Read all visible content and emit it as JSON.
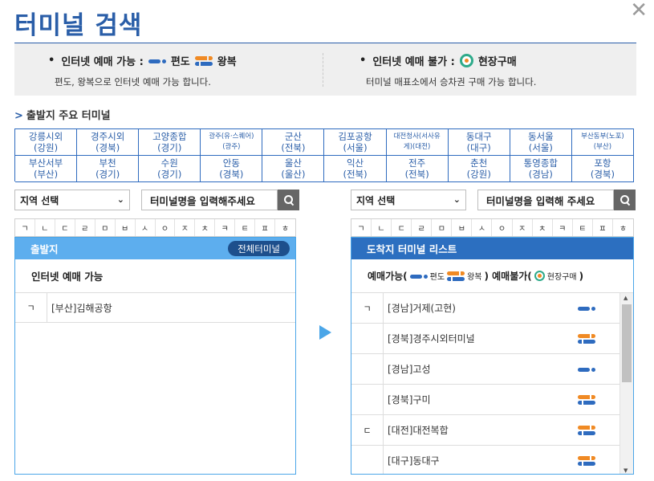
{
  "title": "터미널 검색",
  "close_symbol": "✕",
  "info": {
    "online_head": "인터넷 예매 가능 :",
    "oneway": "편도",
    "roundtrip": "왕복",
    "online_desc": "편도, 왕복으로 인터넷 예매 가능 합니다.",
    "offline_head": "인터넷 예매 불가 :",
    "onsite": "현장구매",
    "offline_desc": "터미널 매표소에서 승차권 구매 가능 합니다."
  },
  "major": {
    "title": "출발지 주요 터미널",
    "cells": [
      "강릉시외\n(강원)",
      "경주시외\n(경북)",
      "고양종합\n(경기)",
      "광주(유·스퀘어)\n(광주)",
      "군산\n(전북)",
      "김포공항\n(서울)",
      "대전청사(서사유\n게)(대전)",
      "동대구\n(대구)",
      "동서울\n(서울)",
      "부산동부(노포)\n(부산)",
      "부산서부\n(부산)",
      "부천\n(경기)",
      "수원\n(경기)",
      "안동\n(경북)",
      "울산\n(울산)",
      "익산\n(전북)",
      "전주\n(전북)",
      "춘천\n(강원)",
      "통영종합\n(경남)",
      "포항\n(경북)"
    ]
  },
  "consonants": [
    "ㄱ",
    "ㄴ",
    "ㄷ",
    "ㄹ",
    "ㅁ",
    "ㅂ",
    "ㅅ",
    "ㅇ",
    "ㅈ",
    "ㅊ",
    "ㅋ",
    "ㅌ",
    "ㅍ",
    "ㅎ"
  ],
  "left": {
    "region": "지역 선택",
    "search_placeholder": "터미널명을 입력해주세요",
    "header": "출발지",
    "all_btn": "전체터미널",
    "subhead": "인터넷 예매 가능",
    "rows": [
      {
        "letter": "ㄱ",
        "name": "[부산]김해공항"
      }
    ]
  },
  "right": {
    "region": "지역 선택",
    "search_placeholder": "터미널명을 입력해 주세요",
    "header": "도착지 터미널 리스트",
    "legend": {
      "avail": "예매가능(",
      "oneway": "편도",
      "round": "왕복",
      "mid": ") 예매불가(",
      "onsite": "현장구매",
      "end": ")"
    },
    "rows": [
      {
        "letter": "ㄱ",
        "name": "[경남]거제(고현)",
        "type": "oneway"
      },
      {
        "letter": "",
        "name": "[경북]경주시외터미널",
        "type": "round"
      },
      {
        "letter": "",
        "name": "[경남]고성",
        "type": "oneway"
      },
      {
        "letter": "",
        "name": "[경북]구미",
        "type": "round"
      },
      {
        "letter": "ㄷ",
        "name": "[대전]대전복합",
        "type": "round"
      },
      {
        "letter": "",
        "name": "[대구]동대구",
        "type": "round"
      }
    ]
  },
  "colors": {
    "brand": "#2a5ea8",
    "panel_light": "#5daeee",
    "panel_dark": "#2c6fc0",
    "oneway": "#2e6bbf",
    "roundtrip": "#f08a24",
    "onsite": "#2eaa8a"
  }
}
